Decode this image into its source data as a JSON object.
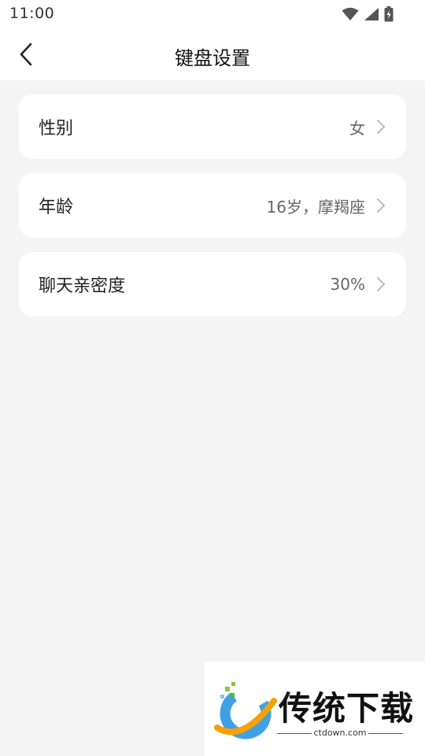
{
  "status_bar": {
    "time": "11:00",
    "icons": [
      "wifi-icon",
      "signal-icon",
      "battery-icon"
    ]
  },
  "app_bar": {
    "title": "键盘设置",
    "back_icon": "chevron-left-icon"
  },
  "settings": [
    {
      "label": "性别",
      "value": "女"
    },
    {
      "label": "年龄",
      "value": "16岁，摩羯座"
    },
    {
      "label": "聊天亲密度",
      "value": "30%"
    }
  ],
  "watermark": {
    "brand": "传统下载",
    "site": "ctdown.com"
  },
  "colors": {
    "background": "#f4f4f4",
    "card": "#ffffff",
    "value_text": "#666666",
    "chevron": "#bbbbbb"
  }
}
